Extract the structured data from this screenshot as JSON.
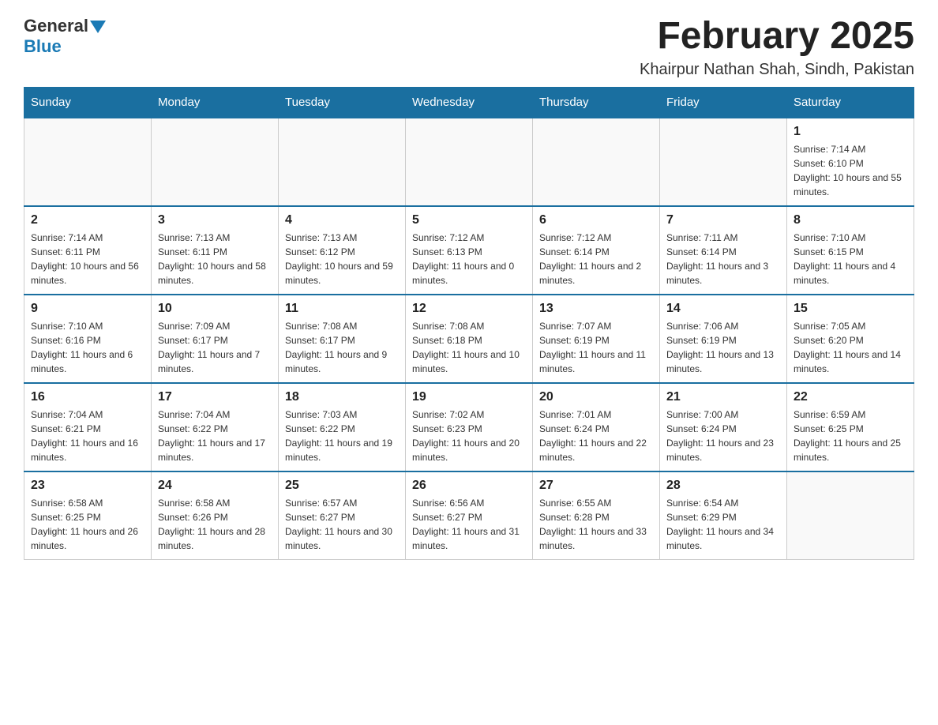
{
  "header": {
    "logo_general": "General",
    "logo_blue": "Blue",
    "month_title": "February 2025",
    "location": "Khairpur Nathan Shah, Sindh, Pakistan"
  },
  "weekdays": [
    "Sunday",
    "Monday",
    "Tuesday",
    "Wednesday",
    "Thursday",
    "Friday",
    "Saturday"
  ],
  "weeks": [
    [
      null,
      null,
      null,
      null,
      null,
      null,
      {
        "day": "1",
        "sunrise": "Sunrise: 7:14 AM",
        "sunset": "Sunset: 6:10 PM",
        "daylight": "Daylight: 10 hours and 55 minutes."
      }
    ],
    [
      {
        "day": "2",
        "sunrise": "Sunrise: 7:14 AM",
        "sunset": "Sunset: 6:11 PM",
        "daylight": "Daylight: 10 hours and 56 minutes."
      },
      {
        "day": "3",
        "sunrise": "Sunrise: 7:13 AM",
        "sunset": "Sunset: 6:11 PM",
        "daylight": "Daylight: 10 hours and 58 minutes."
      },
      {
        "day": "4",
        "sunrise": "Sunrise: 7:13 AM",
        "sunset": "Sunset: 6:12 PM",
        "daylight": "Daylight: 10 hours and 59 minutes."
      },
      {
        "day": "5",
        "sunrise": "Sunrise: 7:12 AM",
        "sunset": "Sunset: 6:13 PM",
        "daylight": "Daylight: 11 hours and 0 minutes."
      },
      {
        "day": "6",
        "sunrise": "Sunrise: 7:12 AM",
        "sunset": "Sunset: 6:14 PM",
        "daylight": "Daylight: 11 hours and 2 minutes."
      },
      {
        "day": "7",
        "sunrise": "Sunrise: 7:11 AM",
        "sunset": "Sunset: 6:14 PM",
        "daylight": "Daylight: 11 hours and 3 minutes."
      },
      {
        "day": "8",
        "sunrise": "Sunrise: 7:10 AM",
        "sunset": "Sunset: 6:15 PM",
        "daylight": "Daylight: 11 hours and 4 minutes."
      }
    ],
    [
      {
        "day": "9",
        "sunrise": "Sunrise: 7:10 AM",
        "sunset": "Sunset: 6:16 PM",
        "daylight": "Daylight: 11 hours and 6 minutes."
      },
      {
        "day": "10",
        "sunrise": "Sunrise: 7:09 AM",
        "sunset": "Sunset: 6:17 PM",
        "daylight": "Daylight: 11 hours and 7 minutes."
      },
      {
        "day": "11",
        "sunrise": "Sunrise: 7:08 AM",
        "sunset": "Sunset: 6:17 PM",
        "daylight": "Daylight: 11 hours and 9 minutes."
      },
      {
        "day": "12",
        "sunrise": "Sunrise: 7:08 AM",
        "sunset": "Sunset: 6:18 PM",
        "daylight": "Daylight: 11 hours and 10 minutes."
      },
      {
        "day": "13",
        "sunrise": "Sunrise: 7:07 AM",
        "sunset": "Sunset: 6:19 PM",
        "daylight": "Daylight: 11 hours and 11 minutes."
      },
      {
        "day": "14",
        "sunrise": "Sunrise: 7:06 AM",
        "sunset": "Sunset: 6:19 PM",
        "daylight": "Daylight: 11 hours and 13 minutes."
      },
      {
        "day": "15",
        "sunrise": "Sunrise: 7:05 AM",
        "sunset": "Sunset: 6:20 PM",
        "daylight": "Daylight: 11 hours and 14 minutes."
      }
    ],
    [
      {
        "day": "16",
        "sunrise": "Sunrise: 7:04 AM",
        "sunset": "Sunset: 6:21 PM",
        "daylight": "Daylight: 11 hours and 16 minutes."
      },
      {
        "day": "17",
        "sunrise": "Sunrise: 7:04 AM",
        "sunset": "Sunset: 6:22 PM",
        "daylight": "Daylight: 11 hours and 17 minutes."
      },
      {
        "day": "18",
        "sunrise": "Sunrise: 7:03 AM",
        "sunset": "Sunset: 6:22 PM",
        "daylight": "Daylight: 11 hours and 19 minutes."
      },
      {
        "day": "19",
        "sunrise": "Sunrise: 7:02 AM",
        "sunset": "Sunset: 6:23 PM",
        "daylight": "Daylight: 11 hours and 20 minutes."
      },
      {
        "day": "20",
        "sunrise": "Sunrise: 7:01 AM",
        "sunset": "Sunset: 6:24 PM",
        "daylight": "Daylight: 11 hours and 22 minutes."
      },
      {
        "day": "21",
        "sunrise": "Sunrise: 7:00 AM",
        "sunset": "Sunset: 6:24 PM",
        "daylight": "Daylight: 11 hours and 23 minutes."
      },
      {
        "day": "22",
        "sunrise": "Sunrise: 6:59 AM",
        "sunset": "Sunset: 6:25 PM",
        "daylight": "Daylight: 11 hours and 25 minutes."
      }
    ],
    [
      {
        "day": "23",
        "sunrise": "Sunrise: 6:58 AM",
        "sunset": "Sunset: 6:25 PM",
        "daylight": "Daylight: 11 hours and 26 minutes."
      },
      {
        "day": "24",
        "sunrise": "Sunrise: 6:58 AM",
        "sunset": "Sunset: 6:26 PM",
        "daylight": "Daylight: 11 hours and 28 minutes."
      },
      {
        "day": "25",
        "sunrise": "Sunrise: 6:57 AM",
        "sunset": "Sunset: 6:27 PM",
        "daylight": "Daylight: 11 hours and 30 minutes."
      },
      {
        "day": "26",
        "sunrise": "Sunrise: 6:56 AM",
        "sunset": "Sunset: 6:27 PM",
        "daylight": "Daylight: 11 hours and 31 minutes."
      },
      {
        "day": "27",
        "sunrise": "Sunrise: 6:55 AM",
        "sunset": "Sunset: 6:28 PM",
        "daylight": "Daylight: 11 hours and 33 minutes."
      },
      {
        "day": "28",
        "sunrise": "Sunrise: 6:54 AM",
        "sunset": "Sunset: 6:29 PM",
        "daylight": "Daylight: 11 hours and 34 minutes."
      },
      null
    ]
  ]
}
